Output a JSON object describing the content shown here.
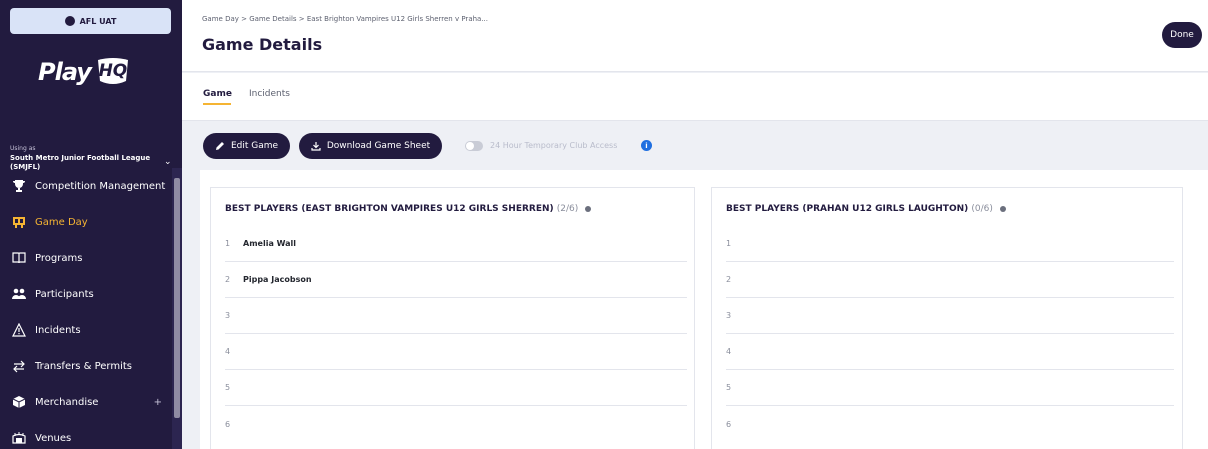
{
  "env": {
    "label": "AFL UAT"
  },
  "logo": {
    "play": "Play",
    "hq": "HQ"
  },
  "org": {
    "using_label": "Using as",
    "name": "South Metro Junior Football League (SMJFL)"
  },
  "nav": {
    "items": [
      {
        "label": "Competition Management",
        "icon": "trophy-icon"
      },
      {
        "label": "Game Day",
        "icon": "scoreboard-icon",
        "active": true
      },
      {
        "label": "Programs",
        "icon": "book-icon"
      },
      {
        "label": "Participants",
        "icon": "people-icon"
      },
      {
        "label": "Incidents",
        "icon": "warning-icon"
      },
      {
        "label": "Transfers & Permits",
        "icon": "transfer-icon"
      },
      {
        "label": "Merchandise",
        "icon": "box-icon",
        "expand": "+"
      },
      {
        "label": "Venues",
        "icon": "stadium-icon"
      }
    ]
  },
  "header": {
    "breadcrumb": "Game Day  >  Game Details  >  East Brighton Vampires U12 Girls Sherren v Praha...",
    "title": "Game Details",
    "done_label": "Done"
  },
  "tabs": [
    {
      "label": "Game",
      "active": true
    },
    {
      "label": "Incidents",
      "active": false
    }
  ],
  "actions": {
    "edit_label": "Edit Game",
    "download_label": "Download Game Sheet",
    "toggle_label": "24 Hour Temporary Club Access",
    "info": "i"
  },
  "best_players": [
    {
      "title": "BEST PLAYERS (EAST BRIGHTON VAMPIRES U12 GIRLS SHERREN)",
      "count": "(2/6)",
      "rows": [
        {
          "num": "1",
          "name": "Amelia Wall"
        },
        {
          "num": "2",
          "name": "Pippa Jacobson"
        },
        {
          "num": "3",
          "name": ""
        },
        {
          "num": "4",
          "name": ""
        },
        {
          "num": "5",
          "name": ""
        },
        {
          "num": "6",
          "name": ""
        }
      ]
    },
    {
      "title": "BEST PLAYERS (PRAHAN U12 GIRLS LAUGHTON)",
      "count": "(0/6)",
      "rows": [
        {
          "num": "1",
          "name": ""
        },
        {
          "num": "2",
          "name": ""
        },
        {
          "num": "3",
          "name": ""
        },
        {
          "num": "4",
          "name": ""
        },
        {
          "num": "5",
          "name": ""
        },
        {
          "num": "6",
          "name": ""
        }
      ]
    }
  ],
  "colors": {
    "sidebar": "#221b3f",
    "accent": "#f5b433",
    "info": "#1f6fe0"
  }
}
